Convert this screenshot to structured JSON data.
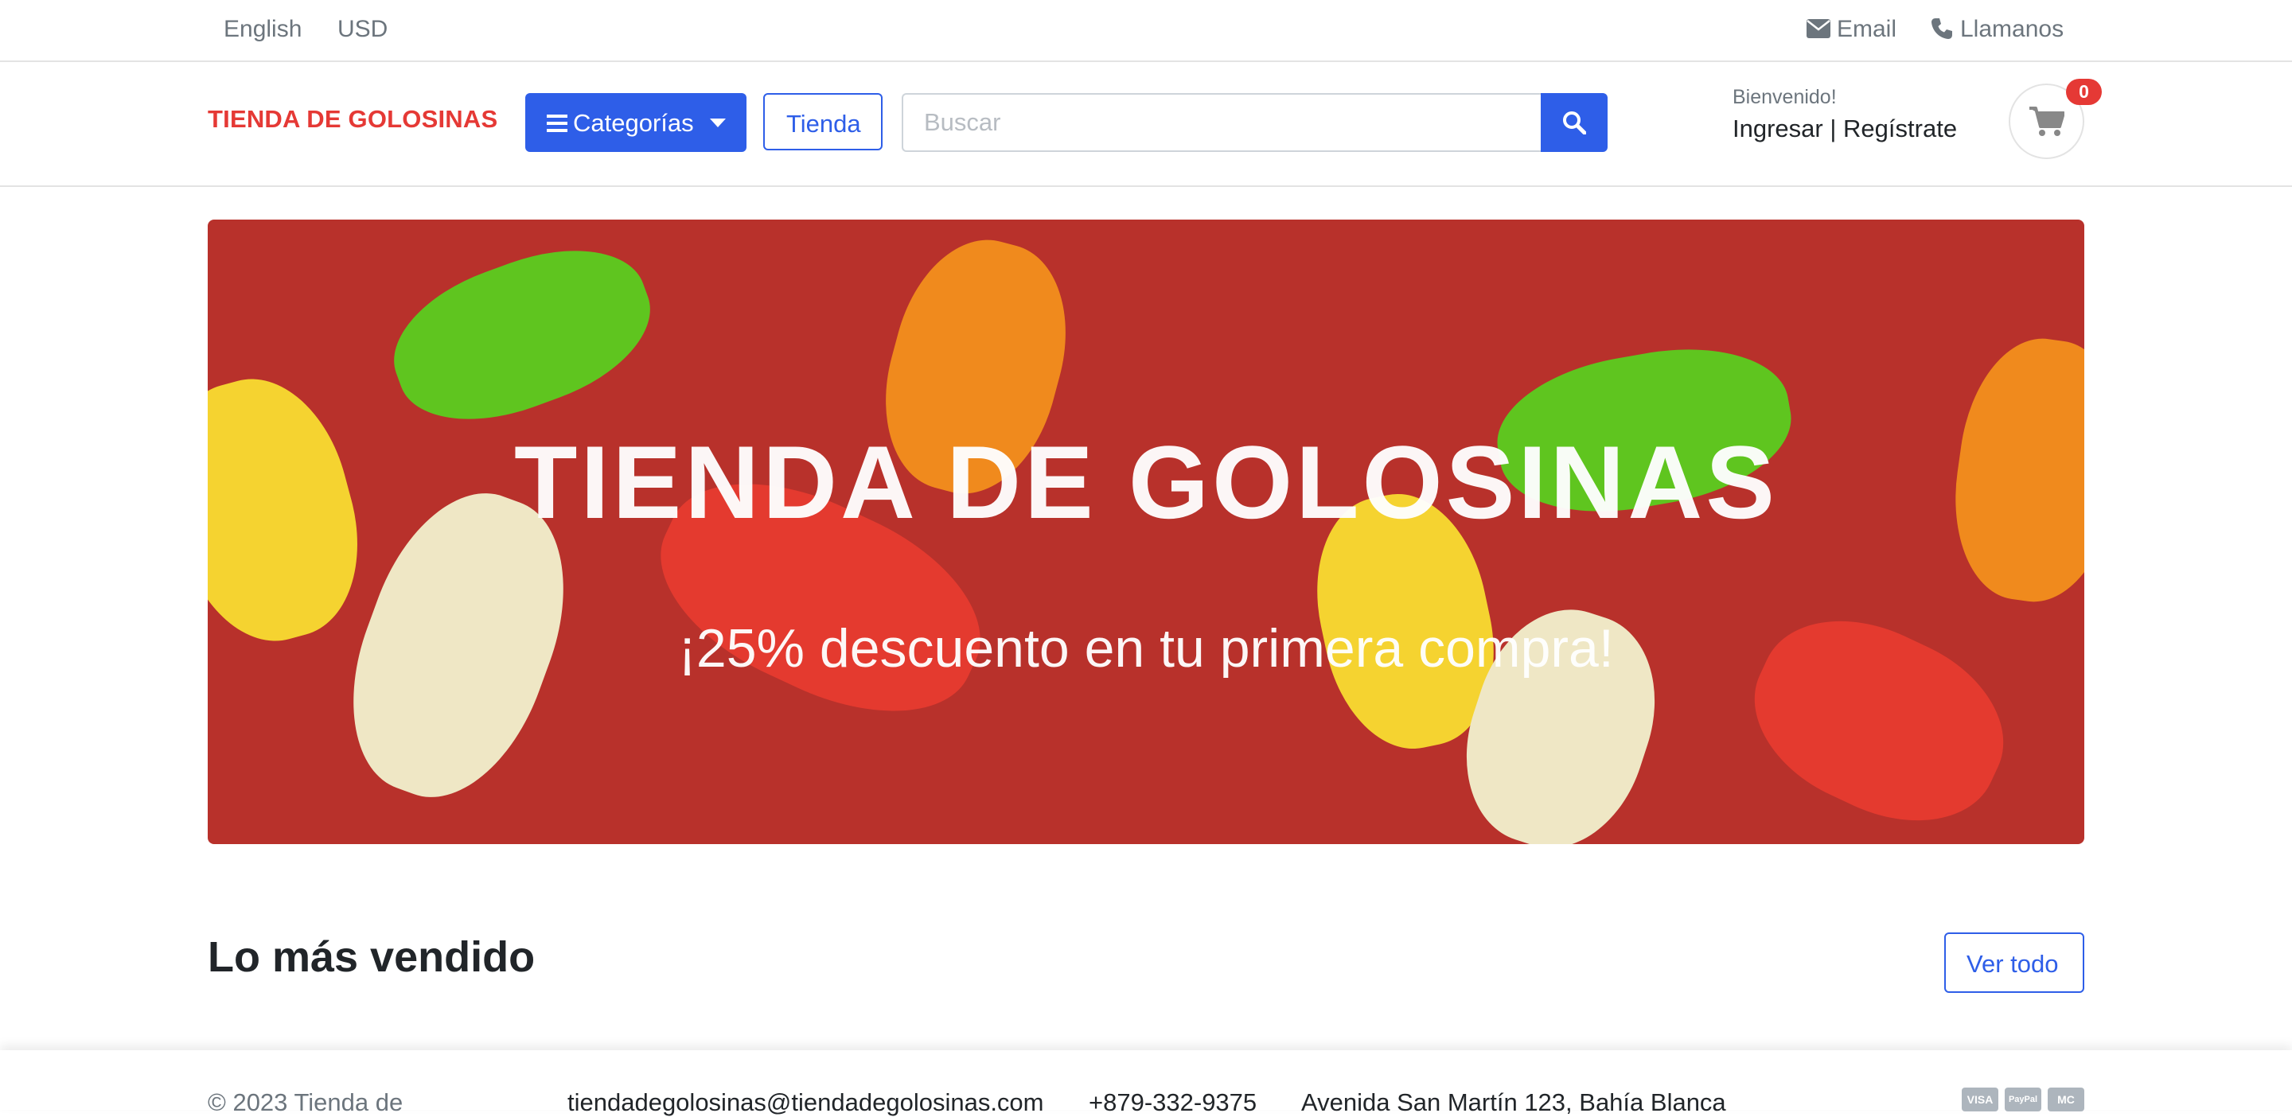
{
  "topbar": {
    "language": "English",
    "currency": "USD",
    "email_label": "Email",
    "call_label": "Llamanos"
  },
  "header": {
    "brand": "TIENDA DE GOLOSINAS",
    "categories_label": "Categorías",
    "shop_label": "Tienda",
    "search_placeholder": "Buscar",
    "search_value": "",
    "welcome": "Bienvenido!",
    "login_label": "Ingresar",
    "separator": "|",
    "register_label": "Regístrate",
    "cart_count": "0"
  },
  "banner": {
    "title": "TIENDA DE GOLOSINAS",
    "subtitle": "¡25% descuento en tu primera compra!"
  },
  "best_sellers": {
    "title": "Lo más vendido",
    "see_all_label": "Ver todo"
  },
  "footer": {
    "copyright": "© 2023 Tienda de",
    "email": "tiendadegolosinas@tiendadegolosinas.com",
    "phone": "+879-332-9375",
    "address": "Avenida San Martín 123, Bahía Blanca",
    "payment_methods": [
      "VISA",
      "PayPal",
      "MC"
    ]
  },
  "colors": {
    "accent": "#2e5ee8",
    "brand": "#e53935",
    "banner_bg": "#b8312b"
  },
  "icons": [
    "envelope-icon",
    "phone-icon",
    "menu-bars-icon",
    "caret-down-icon",
    "search-icon",
    "cart-icon"
  ]
}
